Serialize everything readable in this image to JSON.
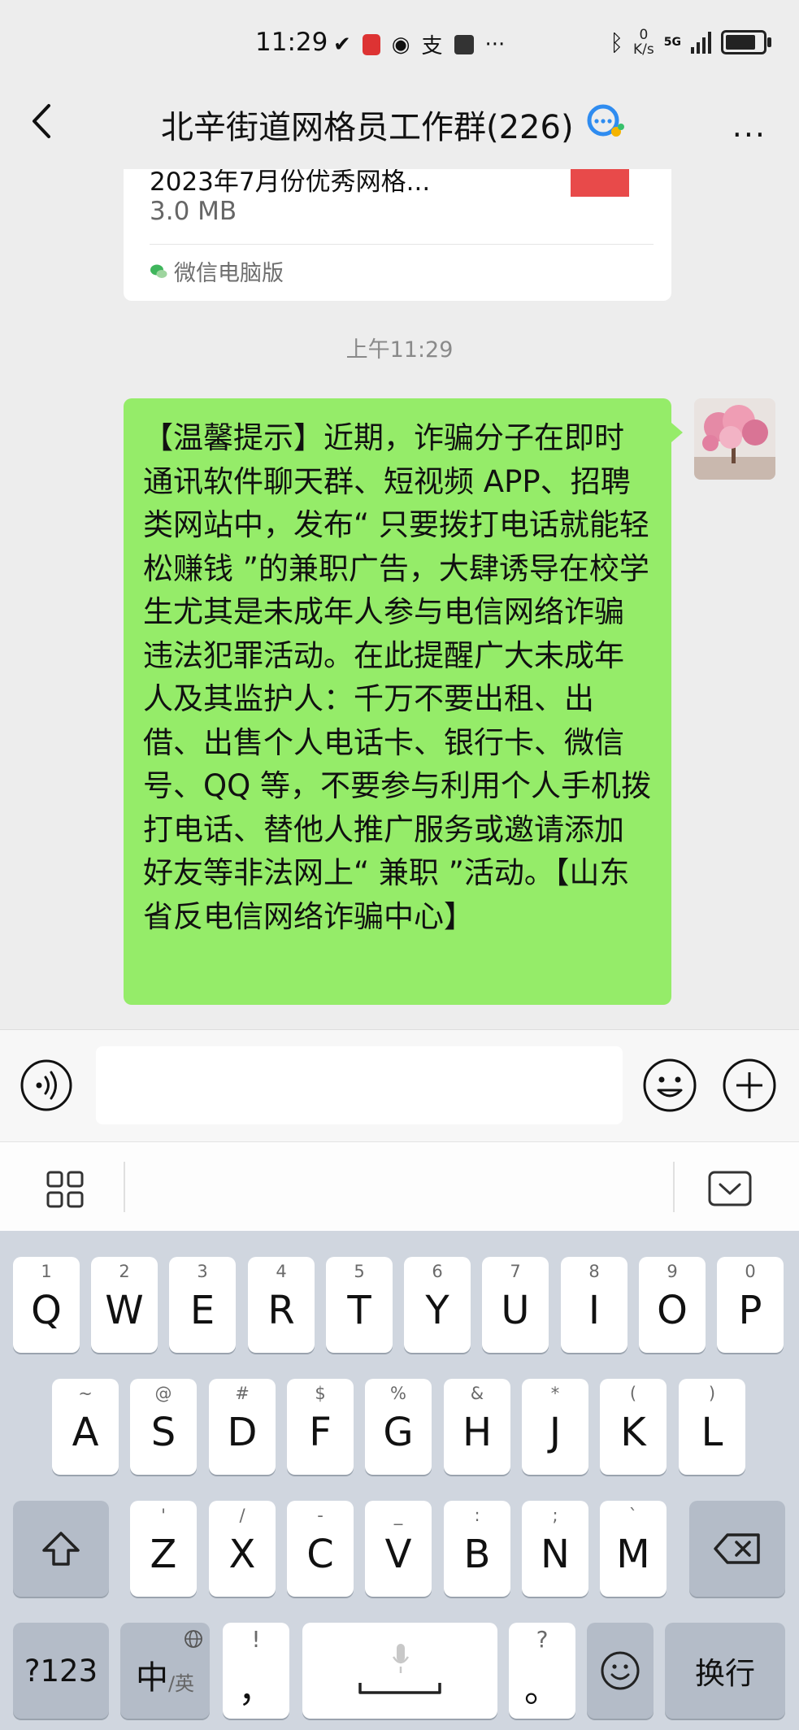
{
  "status_bar": {
    "time": "11:29",
    "net_speed_value": "0",
    "net_speed_unit": "K/s",
    "network_type": "5G",
    "more_indicator": "···"
  },
  "header": {
    "title": "北辛街道网格员工作群(226)"
  },
  "chat": {
    "file_card": {
      "name": "2023年7月份优秀网格...",
      "size": "3.0 MB",
      "source": "微信电脑版"
    },
    "timestamp": "上午11:29",
    "message": "【温馨提示】近期，诈骗分子在即时通讯软件聊天群、短视频 APP、招聘类网站中，发布“ 只要拨打电话就能轻松赚钱 ”的兼职广告，大肆诱导在校学生尤其是未成年人参与电信网络诈骗违法犯罪活动。在此提醒广大未成年人及其监护人：千万不要出租、出借、出售个人电话卡、银行卡、微信号、QQ 等，不要参与利用个人手机拨打电话、替他人推广服务或邀请添加好友等非法网上“ 兼职 ”活动。【山东省反电信网络诈骗中心】"
  },
  "input": {
    "value": ""
  },
  "keyboard": {
    "row1": [
      {
        "num": "1",
        "key": "Q"
      },
      {
        "num": "2",
        "key": "W"
      },
      {
        "num": "3",
        "key": "E"
      },
      {
        "num": "4",
        "key": "R"
      },
      {
        "num": "5",
        "key": "T"
      },
      {
        "num": "6",
        "key": "Y"
      },
      {
        "num": "7",
        "key": "U"
      },
      {
        "num": "8",
        "key": "I"
      },
      {
        "num": "9",
        "key": "O"
      },
      {
        "num": "0",
        "key": "P"
      }
    ],
    "row2": [
      {
        "sym": "~",
        "key": "A"
      },
      {
        "sym": "@",
        "key": "S"
      },
      {
        "sym": "#",
        "key": "D"
      },
      {
        "sym": "$",
        "key": "F"
      },
      {
        "sym": "%",
        "key": "G"
      },
      {
        "sym": "&",
        "key": "H"
      },
      {
        "sym": "*",
        "key": "J"
      },
      {
        "sym": "(",
        "key": "K"
      },
      {
        "sym": ")",
        "key": "L"
      }
    ],
    "row3": [
      {
        "sym": "'",
        "key": "Z"
      },
      {
        "sym": "/",
        "key": "X"
      },
      {
        "sym": "-",
        "key": "C"
      },
      {
        "sym": "_",
        "key": "V"
      },
      {
        "sym": ":",
        "key": "B"
      },
      {
        "sym": ";",
        "key": "N"
      },
      {
        "sym": "`",
        "key": "M"
      }
    ],
    "row4": {
      "num_switch": "?123",
      "lang_main": "中",
      "lang_sub": "/英",
      "comma_sub": "!",
      "comma": "，",
      "period_sub": "?",
      "period": "。",
      "enter": "换行"
    }
  }
}
